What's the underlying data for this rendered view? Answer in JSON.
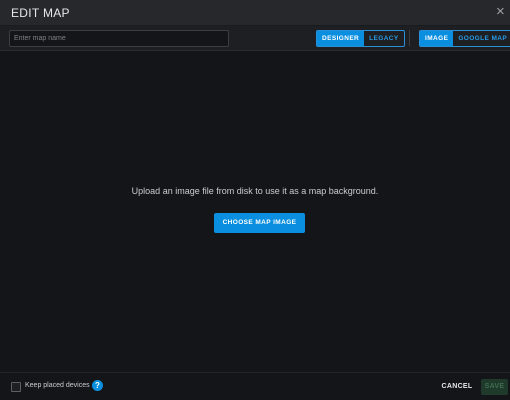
{
  "dialog": {
    "title": "EDIT MAP",
    "close_icon": "×"
  },
  "toolbar": {
    "name_placeholder": "Enter map name",
    "mode_options": [
      "DESIGNER",
      "LEGACY"
    ],
    "mode_selected": "DESIGNER",
    "source_options": [
      "IMAGE",
      "GOOGLE MAP"
    ],
    "source_selected": "IMAGE"
  },
  "canvas": {
    "message": "Upload an image file from disk to use it as a map background.",
    "choose_label": "CHOOSE MAP IMAGE"
  },
  "footer": {
    "keep_devices_label": "Keep placed devices",
    "keep_devices_checked": false,
    "help_icon": "?",
    "cancel_label": "CANCEL",
    "save_label": "SAVE"
  },
  "colors": {
    "accent": "#0a8fe0",
    "background": "#141518",
    "header": "#26282c",
    "save_disabled": "#1f3a2b"
  }
}
